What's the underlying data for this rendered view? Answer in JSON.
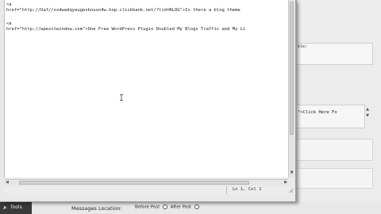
{
  "editor": {
    "lines": [
      "<a",
      "href=\"http://Uaf//xxdwadqyeugevbouvn4w.hop.clickbank.net/?tid=BLOG\">Is there a blog theme",
      "<a",
      "href=\"http://wpexitwindow.com\">One Free WordPress Plugin Doubled My Blogs Traffic and My Li"
    ],
    "cursor_position": "Ln 1, Col 1"
  },
  "background": {
    "side_box_text": "ble:",
    "link_box_text": "\">Click Here Fo",
    "tools_label": "Tools",
    "messages_location_label": "Messages Location:",
    "radio_before": "Before Post",
    "radio_after": "After Post"
  }
}
